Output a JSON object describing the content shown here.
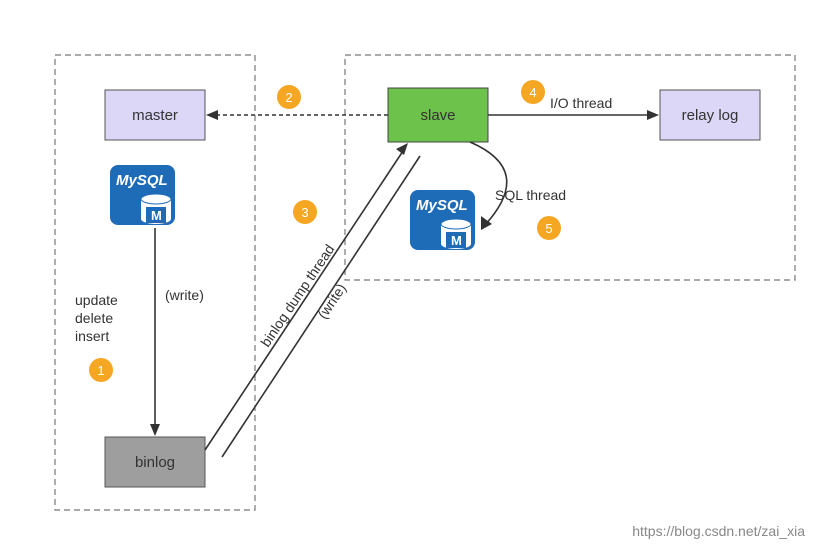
{
  "boxes": {
    "master": {
      "label": "master"
    },
    "slave": {
      "label": "slave"
    },
    "relay_log": {
      "label": "relay log"
    },
    "binlog": {
      "label": "binlog"
    }
  },
  "mysql_logo": {
    "title": "MySQL",
    "badge": "M"
  },
  "edges": {
    "write_master_binlog": "(write)",
    "binlog_dump_thread": "binlog dump thread",
    "write_dump": "(write)",
    "io_thread": "I/O thread",
    "sql_thread": "SQL thread"
  },
  "ops": {
    "line1": "update",
    "line2": "delete",
    "line3": "insert"
  },
  "badges": {
    "b1": "1",
    "b2": "2",
    "b3": "3",
    "b4": "4",
    "b5": "5"
  },
  "watermark": "https://blog.csdn.net/zai_xia"
}
